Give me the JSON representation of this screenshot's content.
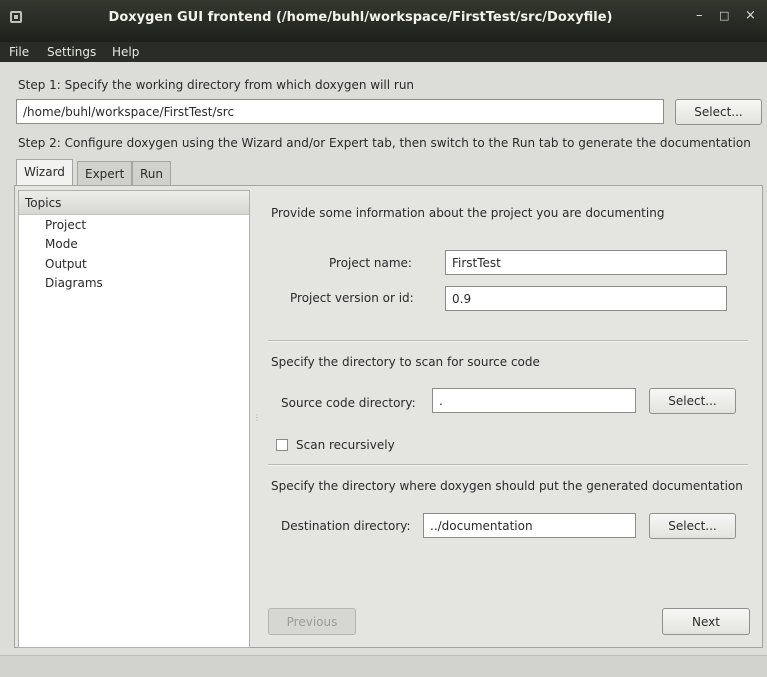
{
  "window": {
    "title": "Doxygen GUI frontend (/home/buhl/workspace/FirstTest/src/Doxyfile)",
    "controls": {
      "minimize": "–",
      "maximize": "□",
      "close": "×"
    }
  },
  "menubar": {
    "items": [
      "File",
      "Settings",
      "Help"
    ]
  },
  "step1": {
    "label": "Step 1: Specify the working directory from which doxygen will run",
    "value": "/home/buhl/workspace/FirstTest/src",
    "select_label": "Select..."
  },
  "step2": {
    "label": "Step 2: Configure doxygen using the Wizard and/or Expert tab, then switch to the Run tab to generate the documentation"
  },
  "tabs": [
    {
      "label": "Wizard",
      "active": true
    },
    {
      "label": "Expert",
      "active": false
    },
    {
      "label": "Run",
      "active": false
    }
  ],
  "topics": {
    "header": "Topics",
    "items": [
      "Project",
      "Mode",
      "Output",
      "Diagrams"
    ]
  },
  "project": {
    "intro": "Provide some information about the project you are documenting",
    "name_label": "Project name:",
    "name_value": "FirstTest",
    "version_label": "Project version or id:",
    "version_value": "0.9"
  },
  "source": {
    "intro": "Specify the directory to scan for source code",
    "dir_label": "Source code directory:",
    "dir_value": ".",
    "select_label": "Select...",
    "recursive_label": "Scan recursively",
    "recursive_checked": false
  },
  "destination": {
    "intro": "Specify the directory where doxygen should put the generated documentation",
    "dir_label": "Destination directory:",
    "dir_value": "../documentation",
    "select_label": "Select..."
  },
  "nav": {
    "previous_label": "Previous",
    "next_label": "Next"
  }
}
